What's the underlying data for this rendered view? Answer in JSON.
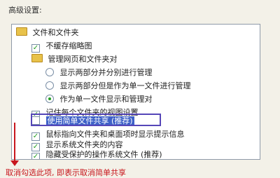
{
  "section_label": "高级设置:",
  "tree": {
    "root_label": "文件和文件夹",
    "item_no_thumbnail_cache": "不缓存缩略图",
    "folder_manage_web_pages": "管理网页和文件夹对",
    "radio_show_separately": "显示两部分并分别进行管理",
    "radio_show_as_single": "显示两部分但是作为单一文件进行管理",
    "radio_show_as_single_file": "作为单一文件显示和管理对",
    "item_remember_view": "记住每个文件夹的视图设置",
    "item_simple_sharing": "使用简单文件共享 (推荐)",
    "item_mouse_tips": "鼠标指向文件夹和桌面项时显示提示信息",
    "item_show_system_contents": "显示系统文件夹的内容",
    "item_hide_protected": "隐藏受保护的操作系统文件 (推荐)"
  },
  "annotation_text": "取消勾选此项, 即表示取消简单共享",
  "colors": {
    "highlight_border": "#5546b8",
    "annotation_red": "#c8161d",
    "check_green": "#239e23"
  }
}
